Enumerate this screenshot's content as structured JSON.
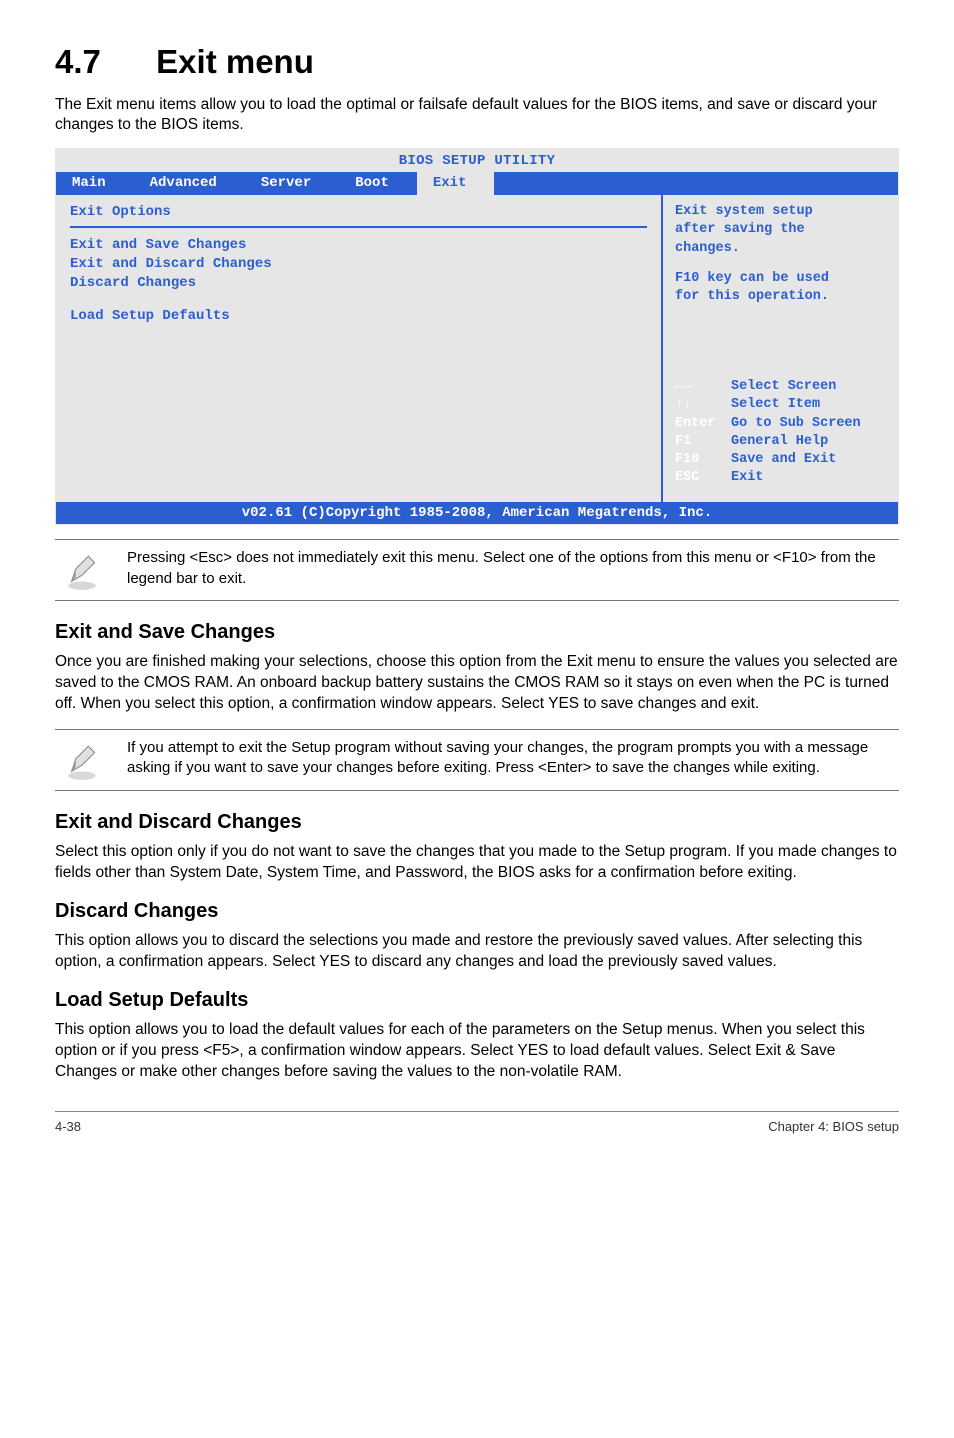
{
  "chapter": {
    "num": "4.7",
    "title": "Exit menu"
  },
  "intro": "The Exit menu items allow you to load the optimal or failsafe default values for the BIOS items, and save or discard your changes to the BIOS items.",
  "bios": {
    "title": "BIOS SETUP UTILITY",
    "tabs": [
      "Main",
      "Advanced",
      "Server",
      "Boot",
      "Exit"
    ],
    "section": "Exit Options",
    "items": [
      "Exit and Save Changes",
      "Exit and Discard Changes",
      "Discard Changes",
      "Load Setup Defaults"
    ],
    "help": {
      "l1": "Exit system setup",
      "l2": "after saving the",
      "l3": "changes.",
      "l4": "F10 key can be used",
      "l5": "for this operation."
    },
    "legend": {
      "r1k": "←→",
      "r1v": "Select Screen",
      "r2k": "↑↓",
      "r2v": "Select Item",
      "r3k": "Enter",
      "r3v": "Go to Sub Screen",
      "r4k": "F1",
      "r4v": "General Help",
      "r5k": "F10",
      "r5v": "Save and Exit",
      "r6k": "ESC",
      "r6v": "Exit"
    },
    "footer": "v02.61 (C)Copyright 1985-2008, American Megatrends, Inc."
  },
  "note1": "Pressing <Esc> does not immediately exit this menu. Select one of the options from this menu or <F10> from the legend bar to exit.",
  "sec1": {
    "title": "Exit and Save Changes",
    "body": "Once you are finished making your selections, choose this option from the Exit menu to ensure the values you selected are saved to the CMOS RAM. An onboard backup battery sustains the CMOS RAM so it stays on even when the PC is turned off. When you select this option, a confirmation window appears. Select YES to save changes and exit."
  },
  "note2": "If you attempt to exit the Setup program without saving your changes, the program prompts you with a message asking if you want to save your changes before exiting. Press <Enter> to save the changes while exiting.",
  "sec2": {
    "title": "Exit and Discard Changes",
    "body": "Select this option only if you do not want to save the changes that you made to the Setup program. If you made changes to fields other than System Date, System Time, and Password, the BIOS asks for a confirmation before exiting."
  },
  "sec3": {
    "title": "Discard Changes",
    "body": "This option allows you to discard the selections you made and restore the previously saved values. After selecting this option, a confirmation appears. Select YES to discard any changes and load the previously saved values."
  },
  "sec4": {
    "title": "Load Setup Defaults",
    "body": "This option allows you to load the default values for each of the parameters on the Setup menus. When you select this option or if you press <F5>, a confirmation window appears. Select YES to load default values. Select Exit & Save Changes or make other changes before saving the values to the non-volatile RAM."
  },
  "footer": {
    "left": "4-38",
    "right": "Chapter 4: BIOS setup"
  }
}
